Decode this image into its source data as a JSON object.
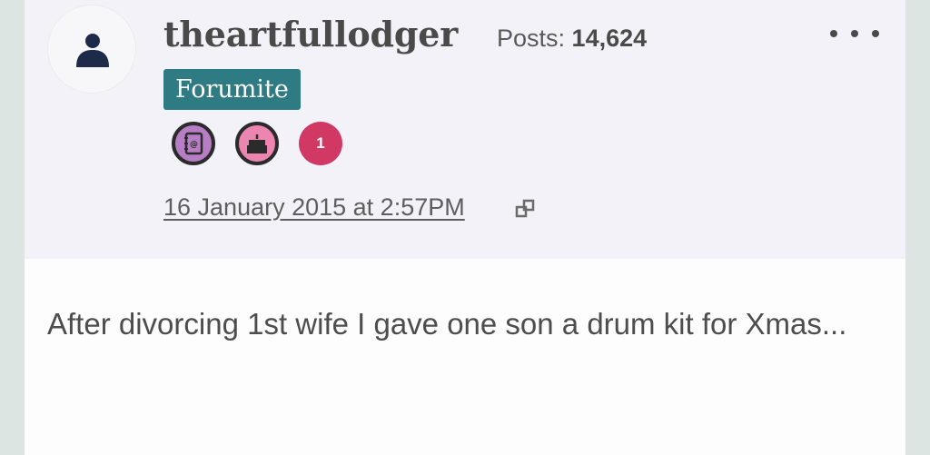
{
  "post": {
    "username": "theartfullodger",
    "posts_label": "Posts:",
    "posts_count": "14,624",
    "rank": "Forumite",
    "badges": [
      {
        "icon": "address-book-icon",
        "color": "#b87ec5"
      },
      {
        "icon": "cake-icon",
        "color": "#ec86b1"
      },
      {
        "count": "1",
        "color": "#d13863"
      }
    ],
    "timestamp": "16 January 2015 at 2:57PM",
    "body": "After divorcing 1st wife I gave one son a drum kit for Xmas..."
  },
  "colors": {
    "rank_bg": "#2f7b84",
    "header_bg": "#f2f2f8",
    "page_bg": "#dde5e3"
  }
}
